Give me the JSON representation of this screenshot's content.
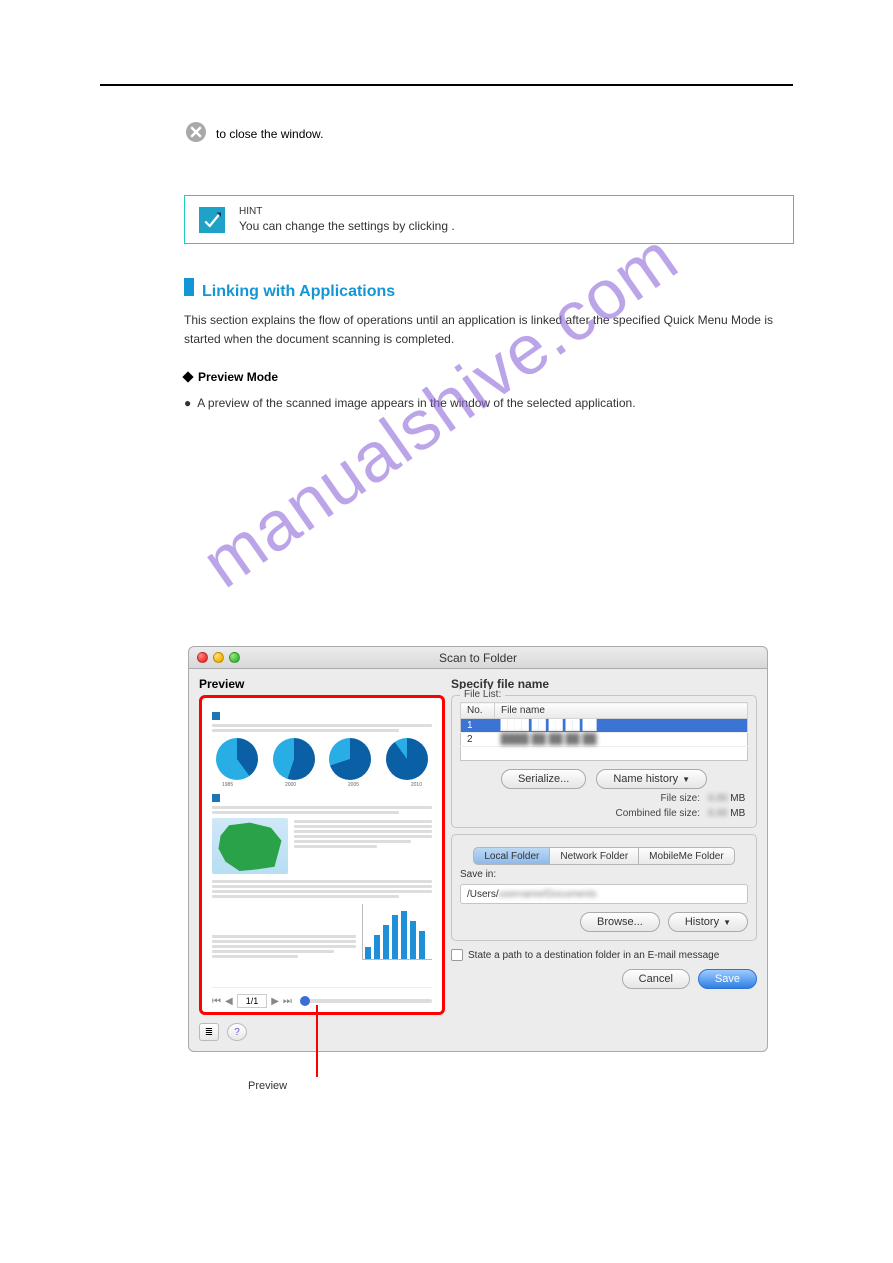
{
  "close_icon_text": "to close the window.",
  "hint": {
    "label": "HINT",
    "text": "You can change the settings by clicking ."
  },
  "section_heading": "Linking with Applications",
  "section_body": "This section explains the flow of operations until an application is linked after the specified Quick Menu Mode is started when the document scanning is completed.",
  "sub_heading": "Preview Mode",
  "preview_body": "A preview of the scanned image appears in the window of the selected application.",
  "watermark": "manualshive.com",
  "callout": "Preview",
  "dialog": {
    "title": "Scan to Folder",
    "preview_label": "Preview",
    "page_indicator": "1/1",
    "pie_years": [
      "1985",
      "2000",
      "2005",
      "2010"
    ],
    "right": {
      "heading": "Specify file name",
      "file_list_label": "File List:",
      "cols": {
        "no": "No.",
        "name": "File name"
      },
      "rows": [
        {
          "no": "1",
          "name": "████ ██ ██ ██ ██"
        },
        {
          "no": "2",
          "name": "████ ██ ██ ██ ██"
        }
      ],
      "serialize": "Serialize...",
      "name_history": "Name history",
      "file_size_label": "File size:",
      "file_size_value": "MB",
      "combined_label": "Combined file size:",
      "combined_value": "MB",
      "tabs": [
        "Local Folder",
        "Network Folder",
        "MobileMe Folder"
      ],
      "save_in": "Save in:",
      "path": "/Users/",
      "browse": "Browse...",
      "history": "History",
      "state_check": "State a path to a destination folder in an E-mail message",
      "cancel": "Cancel",
      "save": "Save"
    }
  }
}
